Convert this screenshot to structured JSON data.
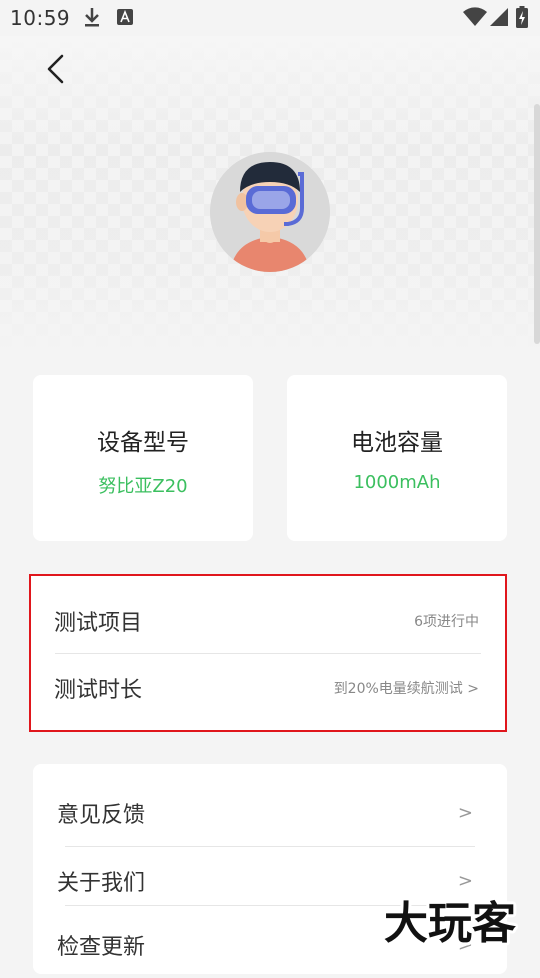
{
  "status_bar": {
    "time": "10:59",
    "icons": [
      "download-icon",
      "a-notification-icon",
      "wifi-icon",
      "signal-icon",
      "battery-charging-icon"
    ]
  },
  "nav": {
    "back_icon": "chevron-left-icon"
  },
  "avatar": {
    "icon": "snorkel-mask-avatar"
  },
  "cards": {
    "device": {
      "title": "设备型号",
      "value": "努比亚Z20"
    },
    "battery": {
      "title": "电池容量",
      "value": "1000mAh"
    }
  },
  "test_panel": {
    "items": [
      {
        "label": "测试项目",
        "value": "6项进行中"
      },
      {
        "label": "测试时长",
        "value": "到20%电量续航测试 >"
      }
    ]
  },
  "menu": {
    "items": [
      {
        "label": "意见反馈",
        "arrow": ">"
      },
      {
        "label": "关于我们",
        "arrow": ">"
      },
      {
        "label": "检查更新",
        "arrow": ">"
      }
    ]
  },
  "watermark": {
    "text": "大玩客"
  },
  "colors": {
    "accent_green": "#3bbf5f",
    "highlight_border": "#e0161c",
    "background": "#f4f4f4",
    "avatar_shirt": "#e8866e",
    "avatar_mask": "#5a6bd6"
  }
}
